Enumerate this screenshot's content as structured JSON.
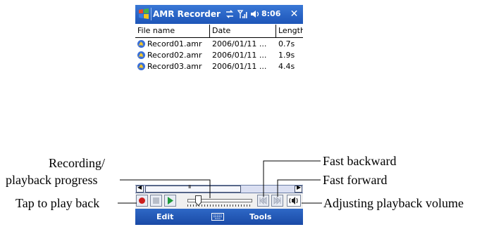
{
  "titlebar": {
    "title": "AMR Recorder",
    "time": "8:06",
    "close_label": "✕"
  },
  "list": {
    "columns": [
      "File name",
      "Date",
      "Length"
    ],
    "rows": [
      {
        "name": "Record01.amr",
        "date": "2006/01/11 ...",
        "length": "0.7s"
      },
      {
        "name": "Record02.amr",
        "date": "2006/01/11 ...",
        "length": "1.9s"
      },
      {
        "name": "Record03.amr",
        "date": "2006/01/11 ...",
        "length": "4.4s"
      }
    ]
  },
  "scrollbar": {
    "left_arrow": "◀",
    "right_arrow": "▶",
    "thumb_grip": "III"
  },
  "menubar": {
    "left": "Edit",
    "right": "Tools"
  },
  "callouts": {
    "recording_progress_1": "Recording/",
    "recording_progress_2": "playback progress",
    "tap_to_play": "Tap to play back",
    "fast_backward": "Fast backward",
    "fast_forward": "Fast forward",
    "adjust_volume": "Adjusting playback volume"
  },
  "icons": {
    "start": "windows-flag-icon",
    "sync": "sync-icon",
    "signal": "signal-icon",
    "speaker": "speaker-icon",
    "record": "record-icon",
    "stop": "stop-icon",
    "play": "play-icon",
    "rewind": "fast-backward-icon",
    "forward": "fast-forward-icon",
    "volume": "volume-icon",
    "keyboard": "keyboard-icon"
  },
  "colors": {
    "titlebar": "#2a66cc",
    "record": "#cc1f1f",
    "play": "#1f9a3a"
  }
}
